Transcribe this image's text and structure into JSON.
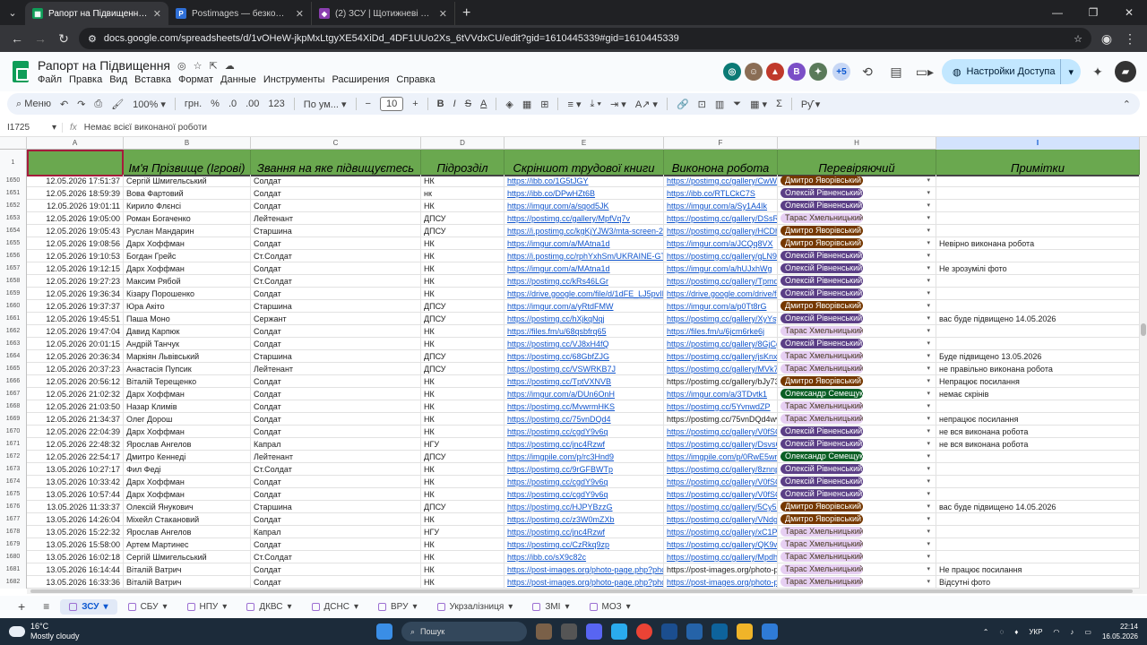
{
  "browser": {
    "tabs": [
      {
        "title": "Рапорт на Підвищення - Goog",
        "fav_color": "#0f9d58",
        "fav_glyph": "▦",
        "active": true
      },
      {
        "title": "Postimages — безкоштовний",
        "fav_color": "#2f6fd6",
        "fav_glyph": "P",
        "active": false
      },
      {
        "title": "(2) ЗСУ | Щотижневі звіти Пол",
        "fav_color": "#8b3fb0",
        "fav_glyph": "◆",
        "active": false
      }
    ],
    "new_tab": "+",
    "url": "docs.google.com/spreadsheets/d/1vOHeW-jkpMxLtgyXE54XiDd_4DF1UUo2Xs_6tVVdxCU/edit?gid=1610445339#gid=1610445339"
  },
  "app": {
    "title": "Рапорт на Підвищення",
    "menus": [
      "Файл",
      "Правка",
      "Вид",
      "Вставка",
      "Формат",
      "Данные",
      "Инструменты",
      "Расширения",
      "Справка"
    ],
    "avatars": [
      {
        "glyph": "◎",
        "color": "#0b7a75"
      },
      {
        "glyph": "☺",
        "color": "#8a6d55"
      },
      {
        "glyph": "▲",
        "color": "#c0392b"
      },
      {
        "glyph": "B",
        "color": "#7b4fc7"
      },
      {
        "glyph": "✦",
        "color": "#5a7a5a"
      }
    ],
    "avatars_more": "+5",
    "share_label": "Настройки Доступа"
  },
  "toolbar": {
    "search": "Меню",
    "zoom": "100%",
    "currency": "грн.",
    "percent": "%",
    "dec_less": ".0",
    "dec_more": ".00",
    "numfmt": "123",
    "font": "По ум...",
    "font_size": "10"
  },
  "formula": {
    "cell_ref": "I1725",
    "content": "Немає всієї виконаної роботи"
  },
  "columns": [
    {
      "letter": "A",
      "header": ""
    },
    {
      "letter": "B",
      "header": "Ім'я Прізвище (Ігрові)"
    },
    {
      "letter": "C",
      "header": "Звання на яке підвищуєтесь"
    },
    {
      "letter": "D",
      "header": "Підрозділ"
    },
    {
      "letter": "E",
      "header": "Скріншот трудової книги"
    },
    {
      "letter": "F",
      "header": "Виконона робота"
    },
    {
      "letter": "H",
      "header": "Перевіряючий"
    },
    {
      "letter": "I",
      "header": "Примітки"
    }
  ],
  "header_row_num": "1",
  "chip_colors": {
    "Олексій Рівненський": 0,
    "Тарас Хмельницький": 1,
    "Дмитро Яворівський": 2,
    "Олександр Семещук": 3
  },
  "rows": [
    {
      "n": "1650",
      "a": "12.05.2026 17:51:37",
      "b": "Сергій Шмигельський",
      "c": "Солдат",
      "d": "НК",
      "e": "https://ibb.co/1G5tJGY",
      "f": "https://postimg.cc/gallery/CwW",
      "h": "Дмитро Яворівський",
      "i": ""
    },
    {
      "n": "1651",
      "a": "12.05.2026 18:59:39",
      "b": "Вова Фартовий",
      "c": "Солдат",
      "d": "нк",
      "e": "https://ibb.co/DPwHZt6B",
      "f": "https://ibb.co/RTLCkC7S",
      "h": "Олексій Рівненський",
      "i": ""
    },
    {
      "n": "1652",
      "a": "12.05.2026 19:01:11",
      "b": "Кирило Флєнсі",
      "c": "Солдат",
      "d": "НК",
      "e": "https://imgur.com/a/sqod5JK",
      "f": "https://imgur.com/a/Sy1A4Ik",
      "h": "Олексій Рівненський",
      "i": ""
    },
    {
      "n": "1653",
      "a": "12.05.2026 19:05:00",
      "b": "Роман Богаченко",
      "c": "Лейтенант",
      "d": "ДПСУ",
      "e": "https://postimg.cc/gallery/MpfVq7v",
      "f": "https://postimg.cc/gallery/DSsR",
      "h": "Тарас Хмельницький",
      "i": ""
    },
    {
      "n": "1654",
      "a": "12.05.2026 19:05:43",
      "b": "Руслан Мандарин",
      "c": "Старшина",
      "d": "ДПСУ",
      "e": "https://i.postimg.cc/kgKjYJW3/mta-screen-20",
      "f": "https://postimg.cc/gallery/HCDh",
      "h": "Дмитро Яворівський",
      "i": ""
    },
    {
      "n": "1655",
      "a": "12.05.2026 19:08:56",
      "b": "Дарх Хоффман",
      "c": "Солдат",
      "d": "НК",
      "e": "https://imgur.com/a/MAtna1d",
      "f": "https://imgur.com/a/JCQq8VX",
      "h": "Дмитро Яворівський",
      "i": "Невірно виконана робота"
    },
    {
      "n": "1656",
      "a": "12.05.2026 19:10:53",
      "b": "Богдан Грейс",
      "c": "Ст.Солдат",
      "d": "НК",
      "e": "https://i.postimg.cc/rphYxhSm/UKRAINE-GT",
      "f": "https://postimg.cc/gallery/gLN9",
      "h": "Олексій Рівненський",
      "i": ""
    },
    {
      "n": "1657",
      "a": "12.05.2026 19:12:15",
      "b": "Дарх Хоффман",
      "c": "Солдат",
      "d": "НК",
      "e": "https://imgur.com/a/MAtna1d",
      "f": "https://imgur.com/a/hUJxhWg",
      "h": "Олексій Рівненський",
      "i": "Не зрозумілі фото"
    },
    {
      "n": "1658",
      "a": "12.05.2026 19:27:23",
      "b": "Максим Рябой",
      "c": "Ст.Солдат",
      "d": "НК",
      "e": "https://postimg.cc/kRs46LGr",
      "f": "https://postimg.cc/gallery/Tpmd",
      "h": "Олексій Рівненський",
      "i": ""
    },
    {
      "n": "1659",
      "a": "12.05.2026 19:36:34",
      "b": "Кізару Порошенко",
      "c": "Солдат",
      "d": "НК",
      "e": "https://drive.google.com/file/d/1dFE_LJ5pvIL",
      "f": "https://drive.google.com/drive/fo",
      "h": "Олексій Рівненський",
      "i": ""
    },
    {
      "n": "1660",
      "a": "12.05.2026 19:37:37",
      "b": "Юра Акіто",
      "c": "Старшина",
      "d": "ДПСУ",
      "e": "https://imgur.com/a/yRtdFMW",
      "f": "https://imgur.com/a/p0Tt8rG",
      "h": "Дмитро Яворівський",
      "i": ""
    },
    {
      "n": "1661",
      "a": "12.05.2026 19:45:51",
      "b": "Паша Моно",
      "c": "Сержант",
      "d": "ДПСУ",
      "e": "https://postimg.cc/hXjkqNqj",
      "f": "https://postimg.cc/gallery/XyYsy",
      "h": "Олексій Рівненський",
      "i": "вас буде підвищено 14.05.2026"
    },
    {
      "n": "1662",
      "a": "12.05.2026 19:47:04",
      "b": "Давид Карпюк",
      "c": "Солдат",
      "d": "НК",
      "e": "https://files.fm/u/68qsbfrq65",
      "f": "https://files.fm/u/6jcm6rke6j",
      "h": "Тарас Хмельницький",
      "i": ""
    },
    {
      "n": "1663",
      "a": "12.05.2026 20:01:15",
      "b": "Андрій Танчук",
      "c": "Солдат",
      "d": "НК",
      "e": "https://postimg.cc/VJ8xH4fQ",
      "f": "https://postimg.cc/gallery/8GjCg",
      "h": "Олексій Рівненський",
      "i": ""
    },
    {
      "n": "1664",
      "a": "12.05.2026 20:36:34",
      "b": "Маркіян Львівський",
      "c": "Старшина",
      "d": "ДПСУ",
      "e": "https://postimg.cc/68GbfZJG",
      "f": "https://postimg.cc/gallery/jsKnxV",
      "h": "Тарас Хмельницький",
      "i": "Буде підвищено 13.05.2026"
    },
    {
      "n": "1665",
      "a": "12.05.2026 20:37:23",
      "b": "Анастасія Пупсик",
      "c": "Лейтенант",
      "d": "ДПСУ",
      "e": "https://postimg.cc/VSWRKB7J",
      "f": "https://postimg.cc/gallery/MVk7",
      "h": "Тарас Хмельницький",
      "i": "не правільно виконана робота"
    },
    {
      "n": "1666",
      "a": "12.05.2026 20:56:12",
      "b": "Віталій Терещенко",
      "c": "Солдат",
      "d": "НК",
      "e": "https://postimg.cc/TptVXNVB",
      "f": "https://postimg.cc/gallery/bJy73",
      "h": "Дмитро Яворівський",
      "i": "Непрацює посилання"
    },
    {
      "n": "1667",
      "a": "12.05.2026 21:02:32",
      "b": "Дарх Хоффман",
      "c": "Солдат",
      "d": "НК",
      "e": "https://imgur.com/a/DUn6OnH",
      "f": "https://imgur.com/a/3TDvtk1",
      "h": "Олександр Семещук",
      "i": "немає скрінів"
    },
    {
      "n": "1668",
      "a": "12.05.2026 21:03:50",
      "b": "Назар Климів",
      "c": "Солдат",
      "d": "НК",
      "e": "https://postimg.cc/MvwrmHKS",
      "f": "https://postimg.cc/5YvnwdZP",
      "h": "Тарас Хмельницький",
      "i": ""
    },
    {
      "n": "1669",
      "a": "12.05.2026 21:34:37",
      "b": "Олег Дорош",
      "c": "Солдат",
      "d": "НК",
      "e": "https://postimg.cc/75vnDQd4",
      "f": "https://postimg.cc/75vnDQd4wv",
      "h": "Тарас Хмельницький",
      "i": "непрацює посилання"
    },
    {
      "n": "1670",
      "a": "12.05.2026 22:04:39",
      "b": "Дарх Хоффман",
      "c": "Солдат",
      "d": "НК",
      "e": "https://postimg.cc/cgdY9v6q",
      "f": "https://postimg.cc/gallery/V0fSC",
      "h": "Олексій Рівненський",
      "i": "не вся виконана робота"
    },
    {
      "n": "1671",
      "a": "12.05.2026 22:48:32",
      "b": "Ярослав Ангелов",
      "c": "Капрал",
      "d": "НГУ",
      "e": "https://postimg.cc/jnc4Rzwf",
      "f": "https://postimg.cc/gallery/DsvsC",
      "h": "Олексій Рівненський",
      "i": "не вся виконана робота"
    },
    {
      "n": "1672",
      "a": "12.05.2026 22:54:17",
      "b": "Дмитро Кеннеді",
      "c": "Лейтенант",
      "d": "ДПСУ",
      "e": "https://imgpile.com/p/rc3Hnd9",
      "f": "https://imgpile.com/p/0RwE5wr",
      "h": "Олександр Семещук",
      "i": ""
    },
    {
      "n": "1673",
      "a": "13.05.2026 10:27:17",
      "b": "Фил Феді",
      "c": "Ст.Солдат",
      "d": "НК",
      "e": "https://postimg.cc/9rGFBWTp",
      "f": "https://postimg.cc/gallery/8znnp",
      "h": "Олексій Рівненський",
      "i": ""
    },
    {
      "n": "1674",
      "a": "13.05.2026 10:33:42",
      "b": "Дарх Хоффман",
      "c": "Солдат",
      "d": "НК",
      "e": "https://postimg.cc/cgdY9v6q",
      "f": "https://postimg.cc/gallery/V0fSC",
      "h": "Олексій Рівненський",
      "i": ""
    },
    {
      "n": "1675",
      "a": "13.05.2026 10:57:44",
      "b": "Дарх Хоффман",
      "c": "Солдат",
      "d": "НК",
      "e": "https://postimg.cc/cgdY9v6q",
      "f": "https://postimg.cc/gallery/V0fSC",
      "h": "Олексій Рівненський",
      "i": ""
    },
    {
      "n": "1676",
      "a": "13.05.2026 11:33:37",
      "b": "Олексій Янукович",
      "c": "Старшина",
      "d": "ДПСУ",
      "e": "https://postimg.cc/HJPYBzzG",
      "f": "https://postimg.cc/gallery/5Cy5r",
      "h": "Дмитро Яворівський",
      "i": "вас буде підвищено 14.05.2026"
    },
    {
      "n": "1677",
      "a": "13.05.2026 14:26:04",
      "b": "Міхейл Стакановий",
      "c": "Солдат",
      "d": "НК",
      "e": "https://postimg.cc/z3W0mZXb",
      "f": "https://postimg.cc/gallery/VNdgl",
      "h": "Дмитро Яворівський",
      "i": ""
    },
    {
      "n": "1678",
      "a": "13.05.2026 15:22:32",
      "b": "Ярослав Ангелов",
      "c": "Капрал",
      "d": "НГУ",
      "e": "https://postimg.cc/jnc4Rzwf",
      "f": "https://postimg.cc/gallery/xC1PV",
      "h": "Тарас Хмельницький",
      "i": ""
    },
    {
      "n": "1679",
      "a": "13.05.2026 15:58:00",
      "b": "Артем Мартинес",
      "c": "Солдат",
      "d": "НК",
      "e": "https://postimg.cc/CzRkq9zp",
      "f": "https://postimg.cc/gallery/QK9w",
      "h": "Тарас Хмельницький",
      "i": ""
    },
    {
      "n": "1680",
      "a": "13.05.2026 16:02:18",
      "b": "Сергій Шмигельський",
      "c": "Ст.Солдат",
      "d": "НК",
      "e": "https://ibb.co/sX9c82c",
      "f": "https://postimg.cc/gallery/Mpdh",
      "h": "Тарас Хмельницький",
      "i": ""
    },
    {
      "n": "1681",
      "a": "13.05.2026 16:14:44",
      "b": "Віталій Ватрич",
      "c": "Солдат",
      "d": "НК",
      "e": "https://post-images.org/photo-page.php?pho",
      "f": "https://post-images.org/photo-p",
      "h": "Тарас Хмельницький",
      "i": "Не працює посилання"
    },
    {
      "n": "1682",
      "a": "13.05.2026 16:33:36",
      "b": "Віталій Ватрич",
      "c": "Солдат",
      "d": "НК",
      "e": "https://post-images.org/photo-page.php?pho",
      "f": "https://post-images.org/photo-p",
      "h": "Тарас Хмельницький",
      "i": "Відсутні фото"
    }
  ],
  "plain_links": [
    "1666",
    "1669",
    "1681"
  ],
  "sheet_tabs": [
    {
      "label": "ЗСУ",
      "active": true
    },
    {
      "label": "СБУ",
      "active": false
    },
    {
      "label": "НПУ",
      "active": false
    },
    {
      "label": "ДКВС",
      "active": false
    },
    {
      "label": "ДСНС",
      "active": false
    },
    {
      "label": "ВРУ",
      "active": false
    },
    {
      "label": "Укрзалізниця",
      "active": false
    },
    {
      "label": "ЗМІ",
      "active": false
    },
    {
      "label": "МОЗ",
      "active": false
    }
  ],
  "taskbar": {
    "temp": "16°C",
    "weather": "Mostly cloudy",
    "search": "Пошук",
    "lang": "УКР",
    "time": "22:14",
    "date": "16.05.2026"
  }
}
